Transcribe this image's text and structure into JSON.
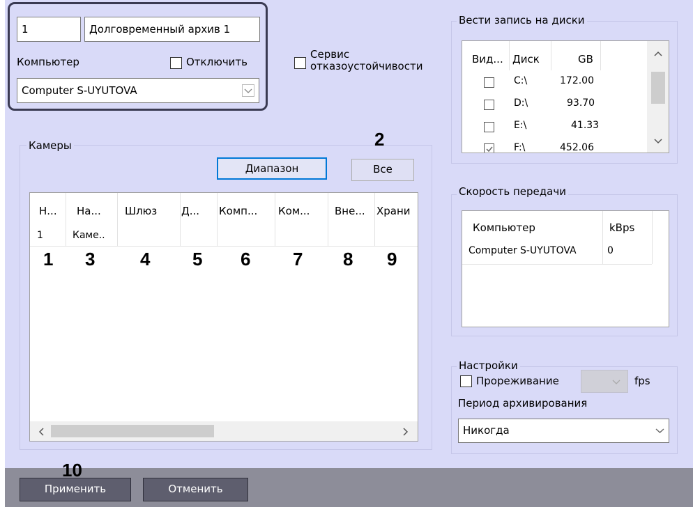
{
  "archive": {
    "number": "1",
    "name": "Долговременный архив 1"
  },
  "computer": {
    "label": "Компьютер",
    "disable_label": "Отключить",
    "selected": "Computer S-UYUTOVA"
  },
  "failover": {
    "line1": "Сервис",
    "line2": "отказоустойчивости"
  },
  "disks": {
    "title": "Вести запись на диски",
    "headers": [
      "Вид...",
      "Диск",
      "GB"
    ],
    "rows": [
      {
        "checked": false,
        "disk": "C:\\",
        "gb": "172.00"
      },
      {
        "checked": false,
        "disk": "D:\\",
        "gb": "93.70"
      },
      {
        "checked": false,
        "disk": "E:\\",
        "gb": "41.33"
      },
      {
        "checked": true,
        "disk": "F:\\",
        "gb": "452.06"
      }
    ]
  },
  "cameras": {
    "title": "Камеры",
    "range_button": "Диапазон",
    "all_button": "Все",
    "headers": [
      "Н...",
      "На...",
      "Шлюз",
      "Д...",
      "Комп...",
      "Ком...",
      "Вне...",
      "Храни"
    ],
    "row": [
      "1",
      "Каме..",
      "",
      "",
      "",
      "",
      "",
      ""
    ]
  },
  "speed": {
    "title": "Скорость передачи",
    "headers": [
      "Компьютер",
      "kBps"
    ],
    "row": [
      "Computer S-UYUTOVA",
      "0"
    ]
  },
  "settings": {
    "title": "Настройки",
    "thinning_label": "Прореживание",
    "fps_label": "fps",
    "period_label": "Период архивирования",
    "period_value": "Никогда"
  },
  "footer": {
    "apply": "Применить",
    "cancel": "Отменить"
  },
  "annotations": [
    "1",
    "2",
    "3",
    "4",
    "5",
    "6",
    "7",
    "8",
    "9",
    "10"
  ],
  "icons": {
    "dropdown": "chevron-down-icon",
    "scroll_up": "chevron-up-icon",
    "scroll_left": "chevron-left-icon",
    "scroll_right": "chevron-right-icon",
    "check": "checkmark-icon"
  },
  "colors": {
    "panel": "#d9daf8",
    "footer": "#8d8d99",
    "focus_border": "#0078d7",
    "highlight_border": "#3a3a52"
  }
}
